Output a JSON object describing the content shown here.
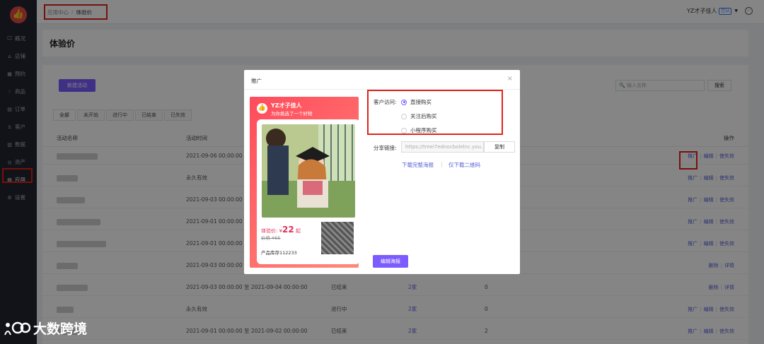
{
  "sidebar": {
    "logo": "👍",
    "items": [
      {
        "icon": "🖵",
        "label": "概况"
      },
      {
        "icon": "⌂",
        "label": "店铺"
      },
      {
        "icon": "▦",
        "label": "预约"
      },
      {
        "icon": "♢",
        "label": "商品"
      },
      {
        "icon": "▤",
        "label": "订单"
      },
      {
        "icon": "♙",
        "label": "客户"
      },
      {
        "icon": "▥",
        "label": "数据"
      },
      {
        "icon": "◎",
        "label": "资产"
      },
      {
        "icon": "▧",
        "label": "应用"
      },
      {
        "icon": "⚙",
        "label": "设置"
      }
    ]
  },
  "topbar": {
    "breadcrumb": [
      "应用中心",
      "体验价"
    ],
    "breadcrumb_sep": "/",
    "user": "YZ才子佳人",
    "badge": "已认",
    "caret": "▼",
    "msg": "···"
  },
  "page": {
    "title": "体验价"
  },
  "content": {
    "new_button": "新建活动",
    "search_placeholder": "输入名称",
    "search_button": "搜索",
    "tabs": [
      "全部",
      "未开始",
      "进行中",
      "已结束",
      "已失效"
    ],
    "columns": {
      "name": "活动名称",
      "time": "活动时间",
      "ops": "操作"
    },
    "rows": [
      {
        "time": "2021-09-06 00:00:00 至",
        "status": "",
        "count": "",
        "num": "",
        "ops": [
          "推广",
          "编辑",
          "使失效"
        ]
      },
      {
        "time": "永久有效",
        "status": "",
        "count": "",
        "num": "",
        "ops": [
          "推广",
          "编辑",
          "使失效"
        ]
      },
      {
        "time": "2021-09-03 00:00:00 至",
        "status": "",
        "count": "",
        "num": "",
        "ops": [
          "推广",
          "编辑",
          "使失效"
        ]
      },
      {
        "time": "2021-09-01 00:00:00 至",
        "status": "",
        "count": "",
        "num": "",
        "ops": [
          "推广",
          "编辑",
          "使失效"
        ]
      },
      {
        "time": "2021-09-01 00:00:00 至",
        "status": "",
        "count": "",
        "num": "",
        "ops": [
          "推广",
          "编辑",
          "使失效"
        ]
      },
      {
        "time": "2021-09-03 00:00:00 至",
        "status": "",
        "count": "",
        "num": "",
        "ops": [
          "删除",
          "详情"
        ]
      },
      {
        "time": "2021-09-03 00:00:00 至 2021-09-04 00:00:00",
        "status": "已结束",
        "count": "2家",
        "num": "0",
        "ops": [
          "删除",
          "详情"
        ]
      },
      {
        "time": "永久有效",
        "status": "进行中",
        "count": "2家",
        "num": "0",
        "ops": [
          "推广",
          "编辑",
          "使失效"
        ]
      },
      {
        "time": "2021-09-01 00:00:00 至 2021-09-02 00:00:00",
        "status": "已结束",
        "count": "2家",
        "num": "2",
        "ops": [
          "推广",
          "编辑",
          "使失效"
        ]
      }
    ]
  },
  "modal": {
    "title": "推广",
    "close": "×",
    "poster": {
      "logo": "👍",
      "shop_name": "YZ才子佳人",
      "subtitle": "为你挑选了一个好物",
      "price_label": "体验价: ¥",
      "price": "22",
      "price_suffix": " 起",
      "original_price": "价格 ¥65",
      "stock": "产品库存112233"
    },
    "access_label": "客户访问:",
    "options": [
      "直接购买",
      "关注后购买",
      "小程序购买"
    ],
    "share_label": "分享链接:",
    "share_link": "https://tmei7ednocbolelnc.you...",
    "copy_button": "复制",
    "download_full": "下载完整海报",
    "download_sep": "|",
    "download_qr": "仅下载二维码",
    "edit_button": "编辑海报"
  },
  "watermark": {
    "text": "大数跨境"
  }
}
